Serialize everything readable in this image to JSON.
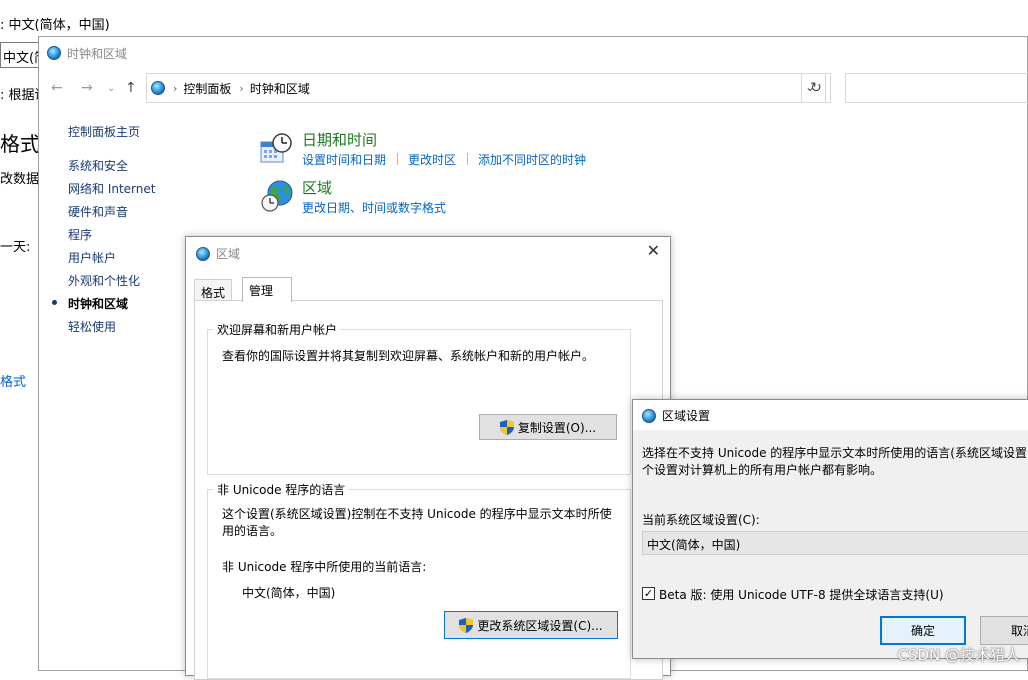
{
  "background_window": {
    "line1": ": 中文(简体，中国)",
    "combo_value": "中文(简",
    "line2": ": 根据语",
    "big_text": "格式数",
    "line3": "改数据格",
    "line4": "一天:",
    "link": "格式"
  },
  "control_panel": {
    "title": "时钟和区域",
    "breadcrumb": [
      "控制面板",
      "时钟和区域"
    ],
    "sidebar": {
      "home": "控制面板主页",
      "items": [
        "系统和安全",
        "网络和 Internet",
        "硬件和声音",
        "程序",
        "用户帐户",
        "外观和个性化",
        "时钟和区域",
        "轻松使用"
      ],
      "active_index": 6
    },
    "categories": [
      {
        "title": "日期和时间",
        "links": [
          "设置时间和日期",
          "更改时区",
          "添加不同时区的时钟"
        ]
      },
      {
        "title": "区域",
        "links": [
          "更改日期、时间或数字格式"
        ]
      }
    ]
  },
  "region_dialog": {
    "title": "区域",
    "tabs": [
      "格式",
      "管理"
    ],
    "selected_tab": 1,
    "welcome_group": {
      "label": "欢迎屏幕和新用户帐户",
      "text": "查看你的国际设置并将其复制到欢迎屏幕、系统帐户和新的用户帐户。",
      "button": "复制设置(O)..."
    },
    "nonunicode_group": {
      "label": "非 Unicode 程序的语言",
      "text_line1": "这个设置(系统区域设置)控制在不支持 Unicode 的程序中显示文本时所使",
      "text_line2": "用的语言。",
      "current_label": "非 Unicode 程序中所使用的当前语言:",
      "current_value": "中文(简体，中国)",
      "button": "更改系统区域设置(C)..."
    }
  },
  "region_settings_dialog": {
    "title": "区域设置",
    "desc_line1": "选择在不支持 Unicode 的程序中显示文本时所使用的语言(系统区域设置)",
    "desc_line2": "个设置对计算机上的所有用户帐户都有影响。",
    "current_label": "当前系统区域设置(C):",
    "current_value": "中文(简体，中国)",
    "beta_checked": true,
    "beta_label": "Beta 版: 使用 Unicode UTF-8 提供全球语言支持(U)",
    "ok": "确定",
    "cancel": "取消"
  },
  "watermark": "CSDN @技术猎人",
  "colors": {
    "link": "#0066cc",
    "category_title": "#1e7a1e",
    "focus": "#0078d7"
  }
}
